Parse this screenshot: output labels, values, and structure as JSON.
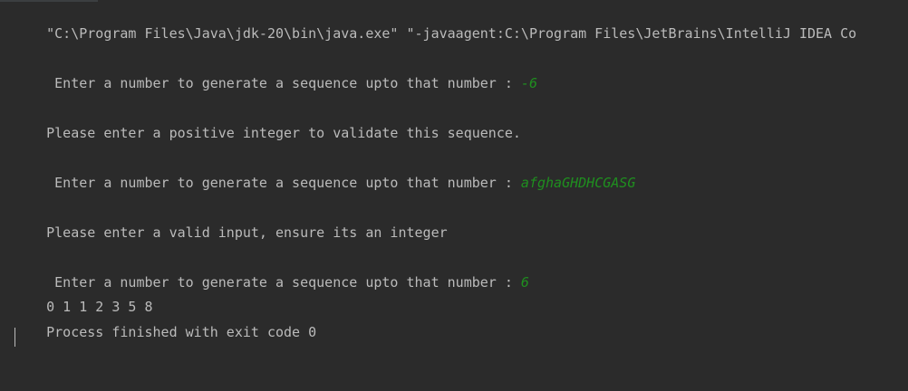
{
  "console": {
    "command_line": "\"C:\\Program Files\\Java\\jdk-20\\bin\\java.exe\" \"-javaagent:C:\\Program Files\\JetBrains\\IntelliJ IDEA Co",
    "prompt_1": " Enter a number to generate a sequence upto that number : ",
    "input_1": "-6",
    "message_1": "Please enter a positive integer to validate this sequence.",
    "prompt_2": " Enter a number to generate a sequence upto that number : ",
    "input_2": "afghaGHDHCGASG",
    "message_2": "Please enter a valid input, ensure its an integer",
    "prompt_3": " Enter a number to generate a sequence upto that number : ",
    "input_3": "6",
    "sequence_output": "0 1 1 2 3 5 8",
    "exit_message": "Process finished with exit code 0"
  },
  "colors": {
    "background": "#2b2b2b",
    "text": "#bbbbbb",
    "user_input": "#1f8f1f"
  }
}
